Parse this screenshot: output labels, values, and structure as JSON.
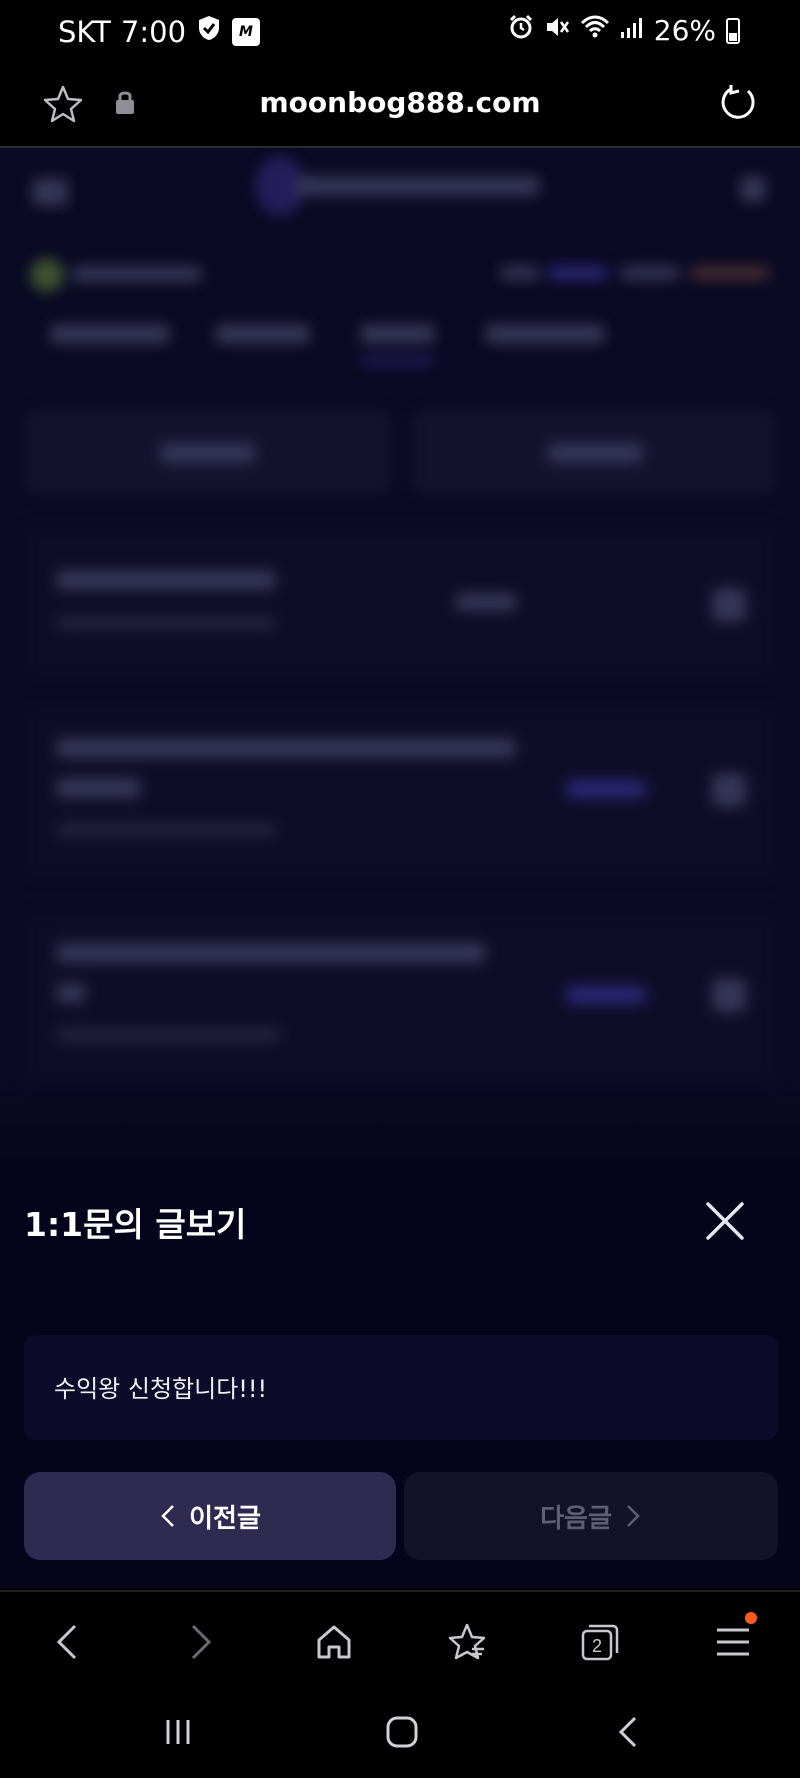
{
  "status_bar": {
    "carrier": "SKT",
    "time": "7:00",
    "mstock_label": "M",
    "battery": "26%"
  },
  "browser": {
    "url": "moonbog888.com",
    "tab_count": "2"
  },
  "sheet": {
    "title": "1:1문의 글보기",
    "message": "수익왕 신청합니다!!!",
    "prev_label": "이전글",
    "next_label": "다음글"
  },
  "colors": {
    "accent": "#2e2a50",
    "badge": "#ff5a1f",
    "sheet_bg": "#04041a"
  }
}
